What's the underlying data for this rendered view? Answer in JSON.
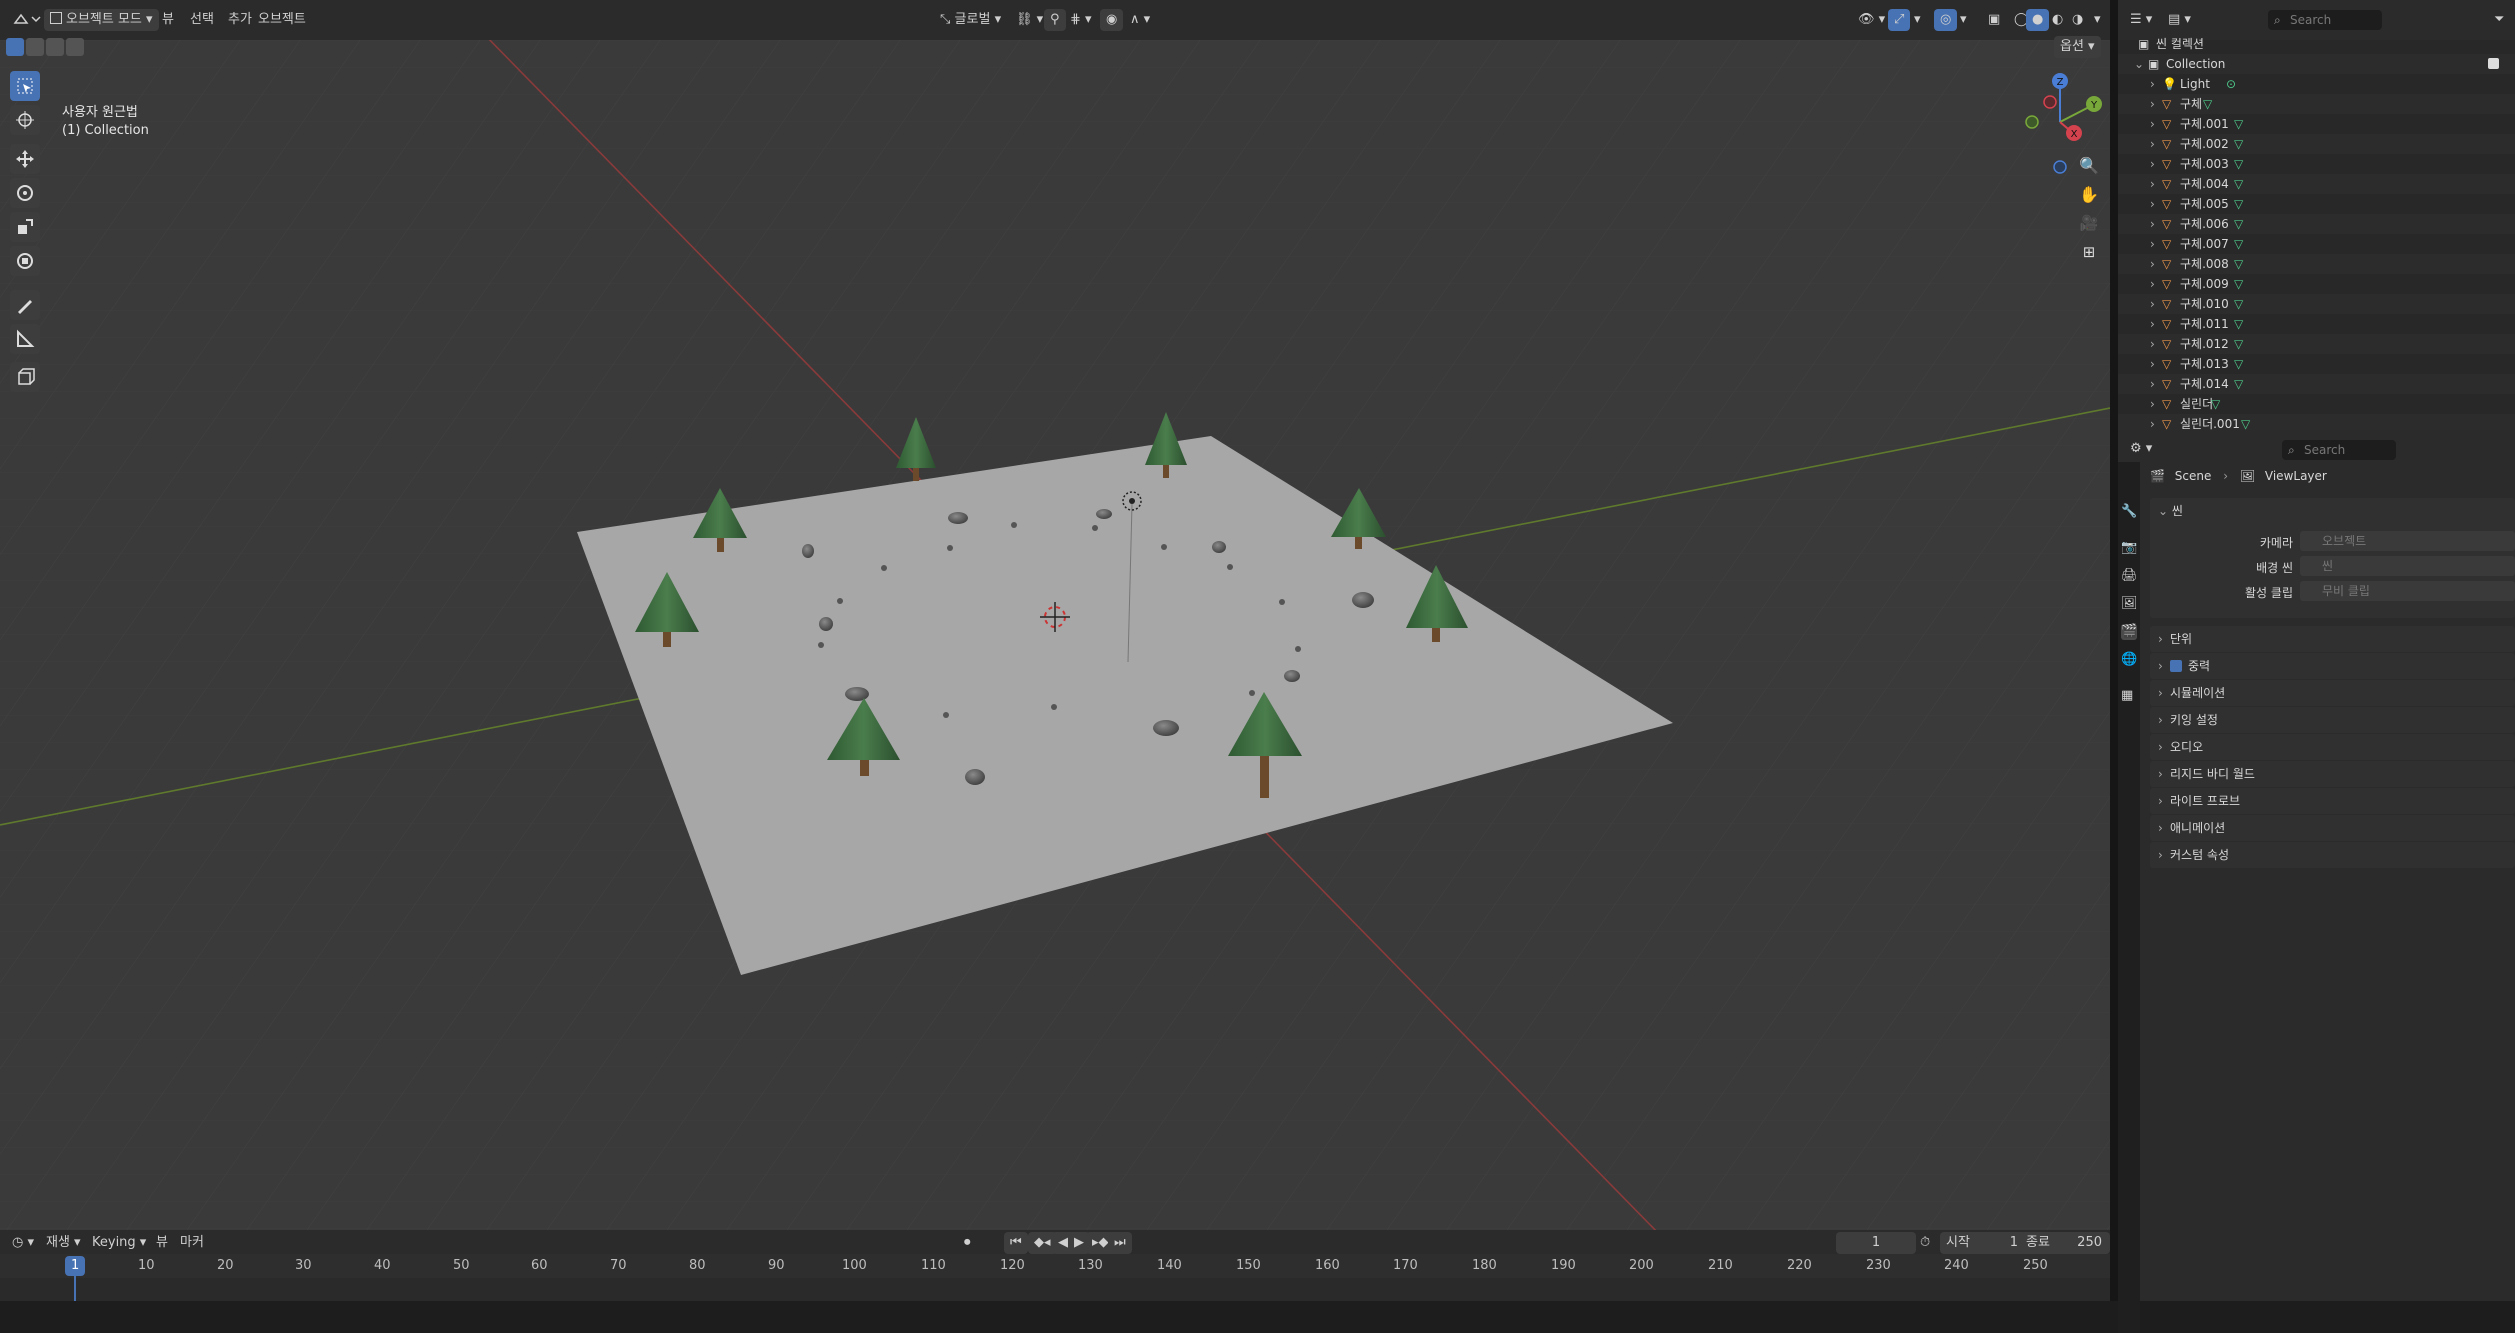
{
  "header": {
    "editor_icon": "view3d-editor-icon",
    "mode_label": "오브젝트 모드",
    "menu": [
      "뷰",
      "선택",
      "추가",
      "오브젝트"
    ],
    "transform_orientation": "글로벌",
    "options_label": "옵션"
  },
  "viewport": {
    "view_name": "사용자 원근법",
    "collection_label": "(1) Collection",
    "gizmo_axes": {
      "x": "X",
      "y": "Y",
      "z": "Z"
    }
  },
  "tools": [
    "select-box-icon",
    "cursor-icon",
    "move-icon",
    "rotate-icon",
    "scale-icon",
    "transform-icon",
    "annotate-icon",
    "measure-icon",
    "add-cube-icon"
  ],
  "timeline": {
    "playback_label": "재생",
    "keying_label": "Keying",
    "view_label": "뷰",
    "marker_label": "마커",
    "current_frame": "1",
    "start_label": "시작",
    "start_value": "1",
    "end_label": "종료",
    "end_value": "250",
    "ticks": [
      "1",
      "10",
      "20",
      "30",
      "40",
      "50",
      "60",
      "70",
      "80",
      "90",
      "100",
      "110",
      "120",
      "130",
      "140",
      "150",
      "160",
      "170",
      "180",
      "190",
      "200",
      "210",
      "220",
      "230",
      "240",
      "250"
    ]
  },
  "outliner": {
    "search_placeholder": "Search",
    "scene_collection": "씬 컬렉션",
    "collection": "Collection",
    "items": [
      {
        "name": "Light",
        "type": "light"
      },
      {
        "name": "구체",
        "type": "mesh"
      },
      {
        "name": "구체.001",
        "type": "mesh"
      },
      {
        "name": "구체.002",
        "type": "mesh"
      },
      {
        "name": "구체.003",
        "type": "mesh"
      },
      {
        "name": "구체.004",
        "type": "mesh"
      },
      {
        "name": "구체.005",
        "type": "mesh"
      },
      {
        "name": "구체.006",
        "type": "mesh"
      },
      {
        "name": "구체.007",
        "type": "mesh"
      },
      {
        "name": "구체.008",
        "type": "mesh"
      },
      {
        "name": "구체.009",
        "type": "mesh"
      },
      {
        "name": "구체.010",
        "type": "mesh"
      },
      {
        "name": "구체.011",
        "type": "mesh"
      },
      {
        "name": "구체.012",
        "type": "mesh"
      },
      {
        "name": "구체.013",
        "type": "mesh"
      },
      {
        "name": "구체.014",
        "type": "mesh"
      },
      {
        "name": "실린더",
        "type": "mesh"
      },
      {
        "name": "실린더.001",
        "type": "mesh"
      }
    ]
  },
  "properties": {
    "search_placeholder": "Search",
    "breadcrumb_scene": "Scene",
    "breadcrumb_layer": "ViewLayer",
    "scene_panel": "씬",
    "camera_label": "카메라",
    "camera_placeholder": "오브젝트",
    "bg_scene_label": "배경 씬",
    "bg_scene_placeholder": "씬",
    "active_clip_label": "활성 클립",
    "active_clip_placeholder": "무비 클립",
    "panels": [
      "단위",
      "중력",
      "시뮬레이션",
      "키잉 설정",
      "오디오",
      "리지드 바디 월드",
      "라이트 프로브",
      "애니메이션",
      "커스텀 속성"
    ]
  },
  "colors": {
    "accent": "#4772b3",
    "mesh_orange": "#e8944a",
    "data_green": "#4ec98a",
    "tree_green": "#3d6b3f"
  }
}
